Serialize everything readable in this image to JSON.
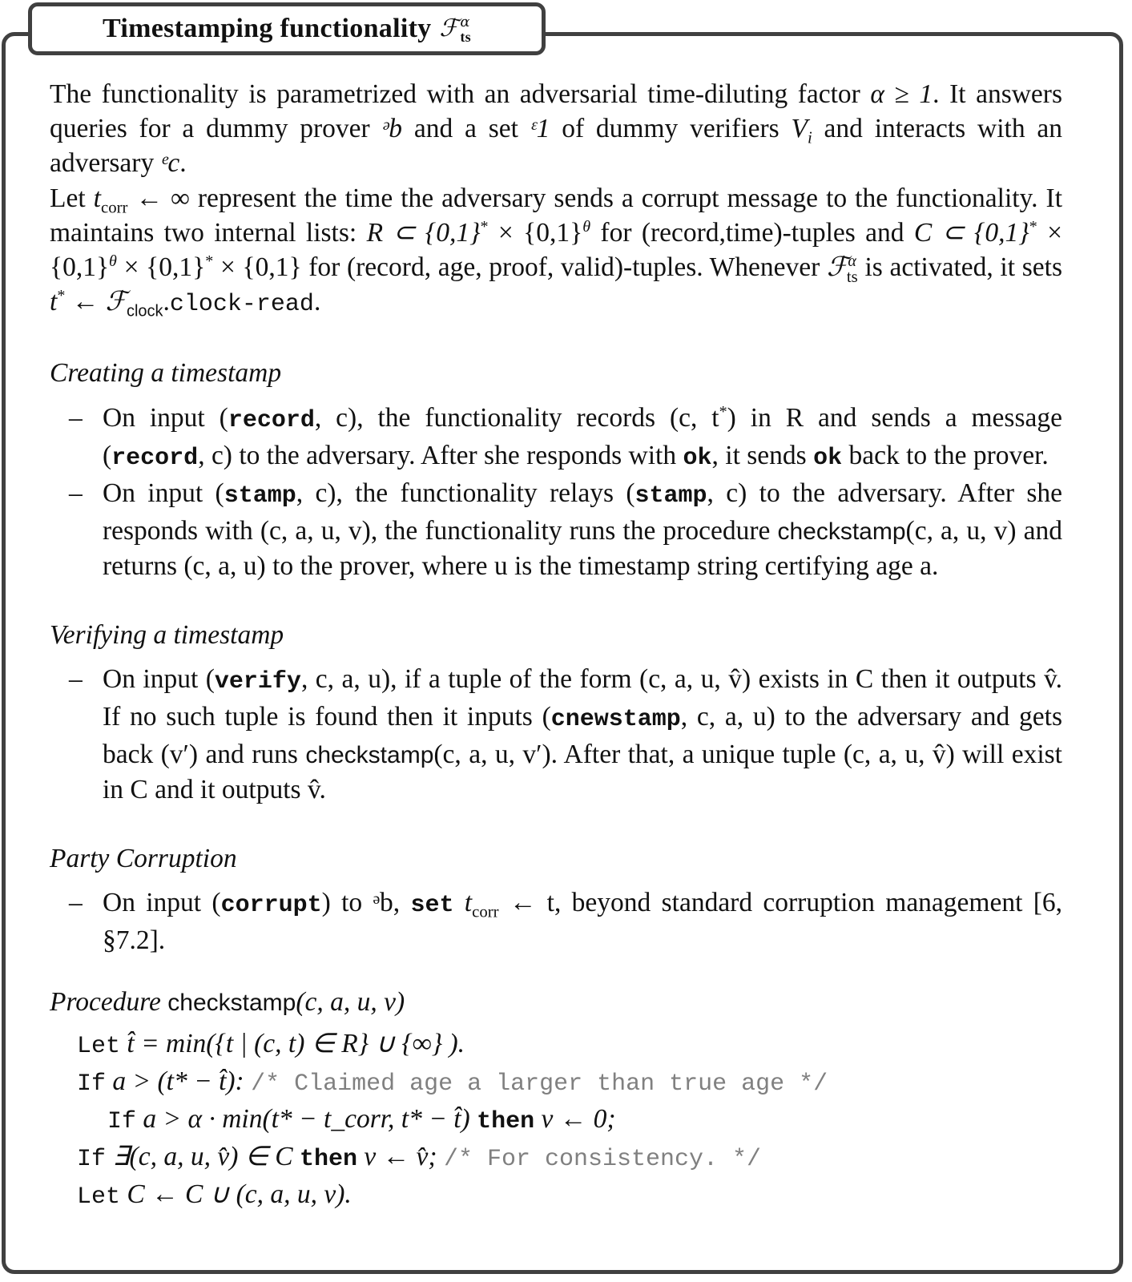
{
  "title": {
    "text": "Timestamping functionality",
    "symbol": "ℱ",
    "symbol_sup": "α",
    "symbol_sub": "ts"
  },
  "intro": {
    "p1": [
      "The functionality is parametrized with an adversarial time-diluting factor ",
      "α ≥ 1",
      ". It answers queries for a dummy prover ",
      "ᵊb",
      " and a set ",
      "ᵋ1",
      " of dummy verifiers ",
      "V",
      "i",
      " and interacts with an adversary ",
      "ᵉc",
      "."
    ],
    "p2": [
      "Let ",
      "t",
      "corr",
      " ← ∞ represent the time the adversary sends a corrupt message to the functionality. It maintains two internal lists: ",
      "R ⊂ {0,1}",
      "*",
      " × {0,1}",
      "θ",
      " for (record,time)-tuples and ",
      "C ⊂ {0,1}",
      "*",
      " × {0,1}",
      "θ",
      " × {0,1}",
      "*",
      " × {0,1}",
      " for (record, age, proof, valid)-tuples. Whenever ",
      "ℱ",
      "α",
      "ts",
      " is activated, it sets ",
      "t",
      "*",
      " ← ℱ",
      "clock",
      ".",
      "clock-read",
      "."
    ]
  },
  "sections": {
    "creating": {
      "heading": "Creating a timestamp",
      "item1": [
        "On input (",
        "record",
        ", c), the functionality records (c, t",
        "*",
        ") in R and sends a message (",
        "record",
        ", c) to the adversary. After she responds with ",
        "ok",
        ", it sends ",
        "ok",
        " back to the prover."
      ],
      "item2": [
        "On input (",
        "stamp",
        ", c), the functionality relays (",
        "stamp",
        ", c) to the adversary. After she responds with (c, a, u, v), the functionality runs the procedure ",
        "checkstamp",
        "(c, a, u, v) and returns (c, a, u) to the prover, where u is the timestamp string certifying age a."
      ]
    },
    "verifying": {
      "heading": "Verifying a timestamp",
      "item1": [
        "On input (",
        "verify",
        ", c, a, u), if a tuple of the form (c, a, u, v̂) exists in C then it outputs v̂. If no such tuple is found then it inputs (",
        "cnewstamp",
        ", c, a, u) to the adversary and gets back (v′) and runs ",
        "checkstamp",
        "(c, a, u, v′). After that, a unique tuple (c, a, u, v̂) will exist in C and it outputs v̂."
      ]
    },
    "corruption": {
      "heading": "Party Corruption",
      "item1": [
        "On input (",
        "corrupt",
        ") to ᵊb, ",
        "set",
        " t",
        "corr",
        " ← t, beyond standard corruption management [6, §7.2]."
      ]
    },
    "procedure": {
      "heading_italic": "Procedure",
      "heading_name": "checkstamp",
      "heading_args": "(c, a, u, v)",
      "lines": [
        {
          "kw": "Let",
          "math": "t̂ = min({t | (c, t) ∈ R} ∪ {∞} ).",
          "comment": ""
        },
        {
          "kw": "If",
          "math": "a > (t* − t̂):",
          "comment": "/* Claimed age a larger than true age */"
        },
        {
          "kw": "If",
          "math": "a > α · min(t* − t_corr, t* − t̂)",
          "kw2": "then",
          "math2": "v ← 0;",
          "comment": ""
        },
        {
          "kw": "If",
          "math": "∃(c, a, u, v̂) ∈ C",
          "kw2": "then",
          "math2": "v ← v̂;",
          "comment": "/* For consistency. */"
        },
        {
          "kw": "Let",
          "math": "C ← C ∪ (c, a, u, v).",
          "comment": ""
        }
      ]
    }
  }
}
